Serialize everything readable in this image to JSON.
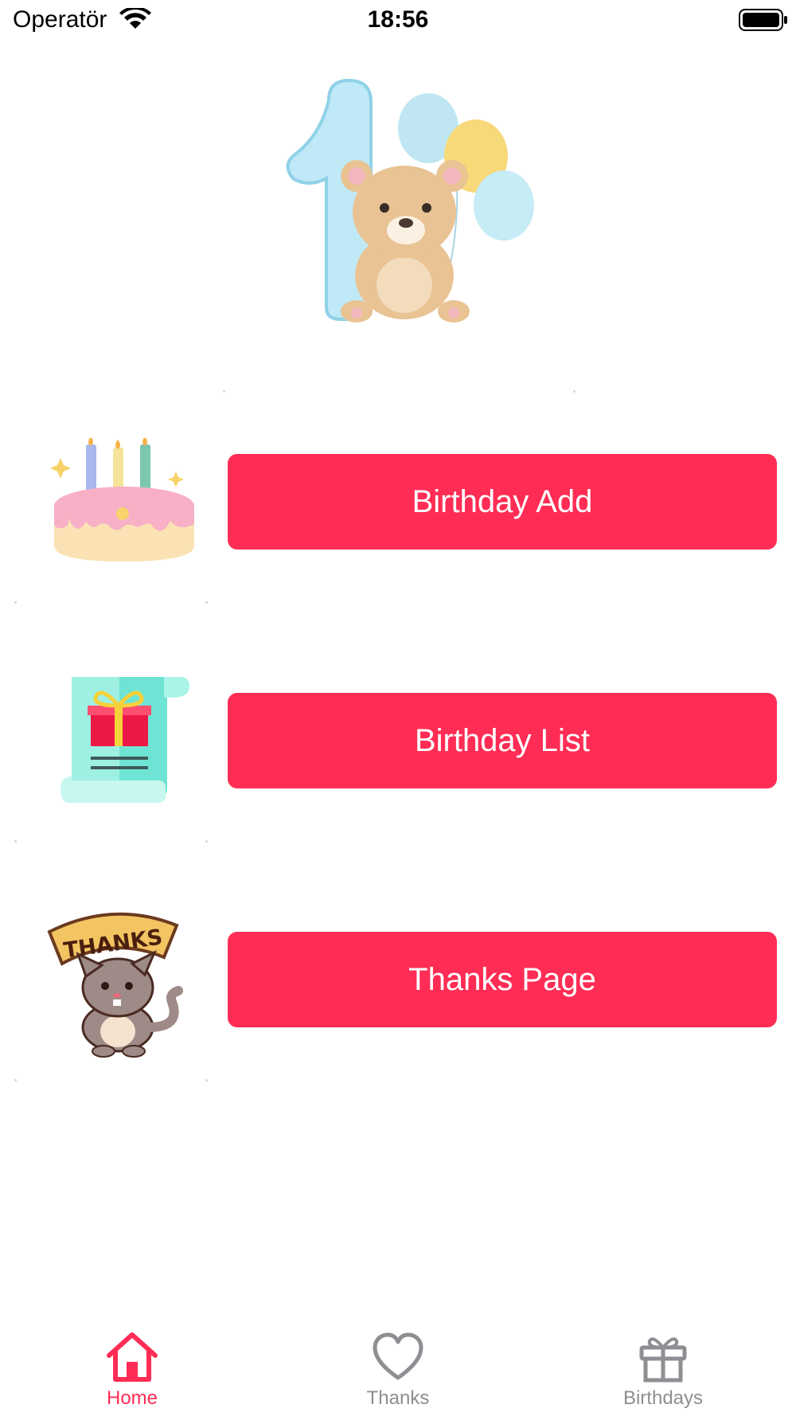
{
  "status_bar": {
    "carrier": "Operatör",
    "time": "18:56"
  },
  "menu": {
    "birthday_add_label": "Birthday Add",
    "birthday_list_label": "Birthday List",
    "thanks_page_label": "Thanks Page",
    "thanks_banner_text": "THANKS"
  },
  "tab_bar": {
    "items": [
      {
        "label": "Home",
        "icon": "house-icon",
        "selected": true
      },
      {
        "label": "Thanks",
        "icon": "heart-icon",
        "selected": false
      },
      {
        "label": "Birthdays",
        "icon": "gift-icon",
        "selected": false
      }
    ]
  },
  "colors": {
    "accent": "#ff2d55",
    "tab_inactive": "#8e8e93",
    "background": "#ffffff"
  }
}
